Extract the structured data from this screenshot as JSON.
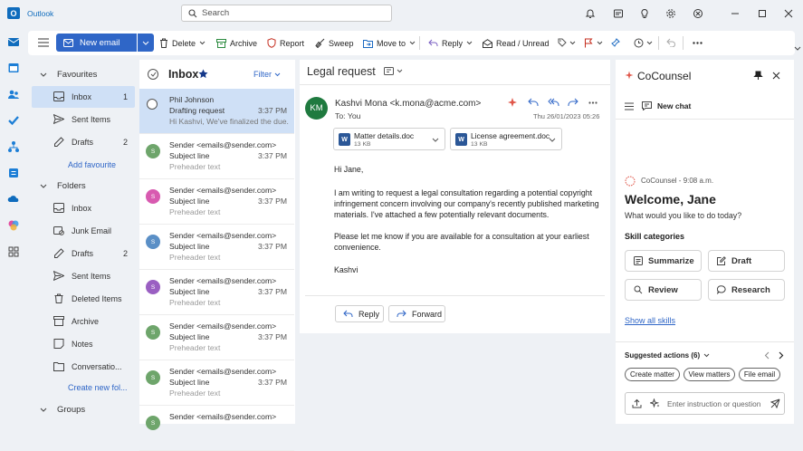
{
  "app": {
    "name": "Outlook"
  },
  "search": {
    "placeholder": "Search"
  },
  "toolbar": {
    "new_mail": "New email",
    "delete": "Delete",
    "archive": "Archive",
    "report": "Report",
    "sweep": "Sweep",
    "move_to": "Move to",
    "reply": "Reply",
    "read_unread": "Read / Unread"
  },
  "sidebar": {
    "favourites_header": "Favourites",
    "favourites": [
      {
        "label": "Inbox",
        "count": "1"
      },
      {
        "label": "Sent Items",
        "count": ""
      },
      {
        "label": "Drafts",
        "count": "2"
      }
    ],
    "add_favourite": "Add favourite",
    "folders_header": "Folders",
    "folders": [
      {
        "label": "Inbox",
        "count": ""
      },
      {
        "label": "Junk Email",
        "count": ""
      },
      {
        "label": "Drafts",
        "count": "2"
      },
      {
        "label": "Sent Items",
        "count": ""
      },
      {
        "label": "Deleted Items",
        "count": ""
      },
      {
        "label": "Archive",
        "count": ""
      },
      {
        "label": "Notes",
        "count": ""
      },
      {
        "label": "Conversatio...",
        "count": ""
      }
    ],
    "create_folder": "Create new fol...",
    "groups_header": "Groups"
  },
  "mail_list": {
    "title": "Inbox",
    "filter": "Filter",
    "items": [
      {
        "sender": "Phil Johnson",
        "subject": "Drafting request",
        "preview": "Hi Kashvi, We've finalized the due...",
        "time": "3:37 PM",
        "avatar": "",
        "avatar_color": ""
      },
      {
        "sender": "Sender <emails@sender.com>",
        "subject": "Subject line",
        "preview": "Preheader text",
        "time": "3:37 PM",
        "avatar": "S",
        "avatar_color": "#6ea56b"
      },
      {
        "sender": "Sender <emails@sender.com>",
        "subject": "Subject line",
        "preview": "Preheader text",
        "time": "3:37 PM",
        "avatar": "S",
        "avatar_color": "#d85ab0"
      },
      {
        "sender": "Sender <emails@sender.com>",
        "subject": "Subject line",
        "preview": "Preheader text",
        "time": "3:37 PM",
        "avatar": "S",
        "avatar_color": "#5a8fc6"
      },
      {
        "sender": "Sender <emails@sender.com>",
        "subject": "Subject line",
        "preview": "Preheader text",
        "time": "3:37 PM",
        "avatar": "S",
        "avatar_color": "#9a5fc2"
      },
      {
        "sender": "Sender <emails@sender.com>",
        "subject": "Subject line",
        "preview": "Preheader text",
        "time": "3:37 PM",
        "avatar": "S",
        "avatar_color": "#6ea56b"
      },
      {
        "sender": "Sender <emails@sender.com>",
        "subject": "Subject line",
        "preview": "Preheader text",
        "time": "3:37 PM",
        "avatar": "S",
        "avatar_color": "#6ea56b"
      },
      {
        "sender": "Sender <emails@sender.com>",
        "subject": "",
        "preview": "",
        "time": "",
        "avatar": "S",
        "avatar_color": "#6ea56b"
      }
    ]
  },
  "reading": {
    "subject": "Legal request",
    "avatar": "KM",
    "from": "Kashvi Mona <k.mona@acme.com>",
    "to": "To:  You",
    "date": "Thu 26/01/2023 05:26",
    "attachments": [
      {
        "name": "Matter details.doc",
        "size": "13 KB"
      },
      {
        "name": "License agreement.doc",
        "size": "13 KB"
      }
    ],
    "greeting": "Hi Jane,",
    "body1": "I am writing to request a legal consultation regarding a potential copyright infringement concern involving our company's recently published marketing materials. I've attached a few potentially relevant documents.",
    "body2": "Please let me know if you are available for a consultation at your earliest convenience.",
    "signature": "Kashvi",
    "reply": "Reply",
    "forward": "Forward"
  },
  "cocounsel": {
    "title": "CoCounsel",
    "new_chat": "New chat",
    "meta": "CoCounsel - 9:08 a.m.",
    "welcome": "Welcome, Jane",
    "prompt": "What would you like to do today?",
    "skills_header": "Skill categories",
    "skills": [
      "Summarize",
      "Draft",
      "Review",
      "Research"
    ],
    "show_all": "Show all skills",
    "suggested": "Suggested actions (6)",
    "pills": [
      "Create matter",
      "View matters",
      "File email"
    ],
    "input_placeholder": "Enter instruction or question"
  },
  "colors": {
    "accent": "#2f66c7",
    "selected": "#cfe0f6",
    "km_avatar": "#1f7a3f"
  }
}
